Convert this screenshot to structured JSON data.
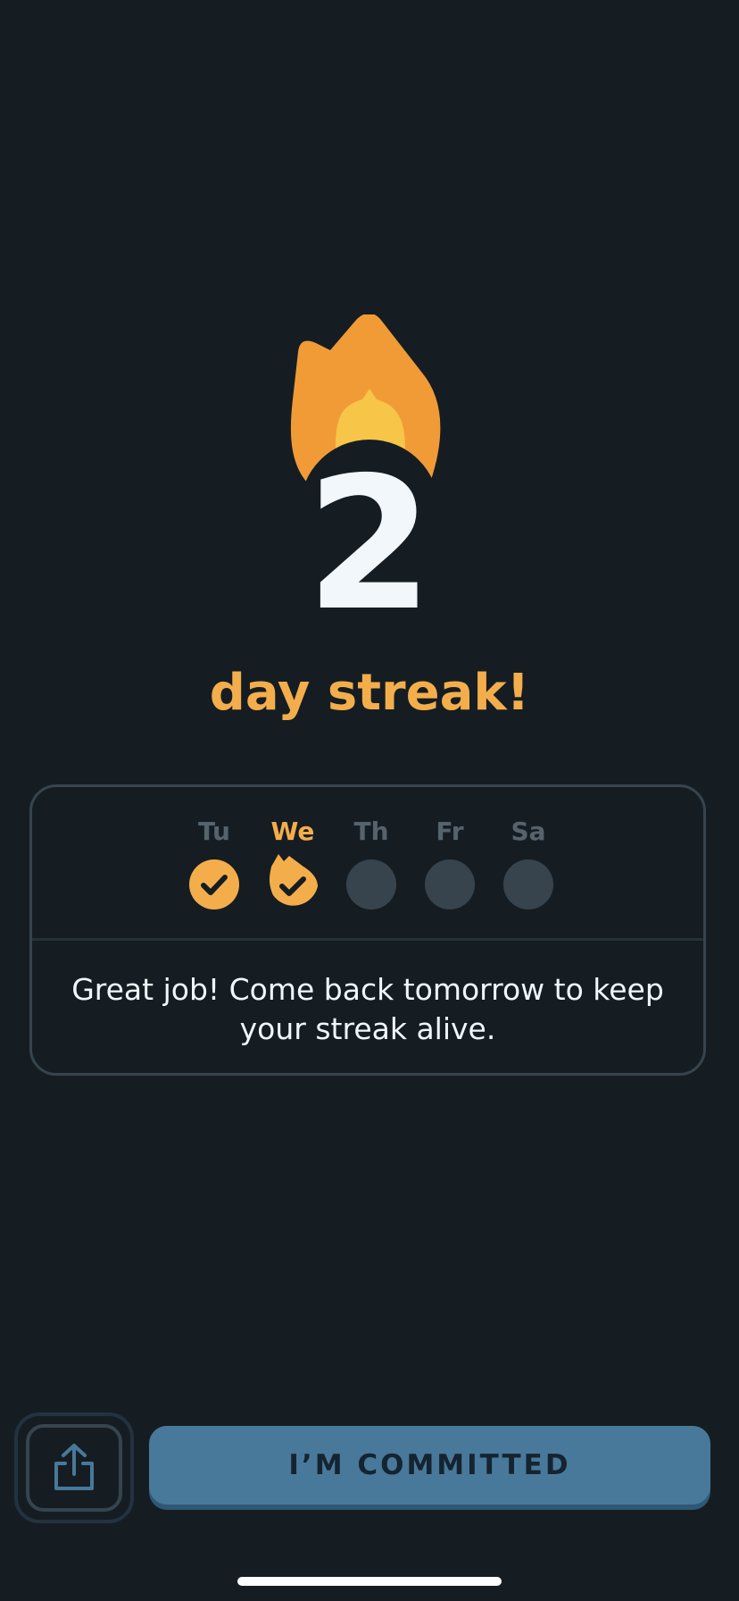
{
  "streak": {
    "count": "2",
    "label": "day streak!"
  },
  "week": {
    "days": [
      {
        "label": "Tu",
        "status": "completed",
        "icon": "check-icon"
      },
      {
        "label": "We",
        "status": "today-completed",
        "icon": "flame-check-icon"
      },
      {
        "label": "Th",
        "status": "upcoming"
      },
      {
        "label": "Fr",
        "status": "upcoming"
      },
      {
        "label": "Sa",
        "status": "upcoming"
      }
    ],
    "message": "Great job! Come back tomorrow to keep your streak alive."
  },
  "actions": {
    "share_icon": "share-icon",
    "commit_label": "I’M COMMITTED"
  },
  "colors": {
    "background": "#151d23",
    "accent_orange": "#f3ae4b",
    "flame_orange": "#f19b37",
    "flame_yellow": "#f7c548",
    "inactive_dot": "#37444d",
    "button_blue": "#48799a"
  }
}
